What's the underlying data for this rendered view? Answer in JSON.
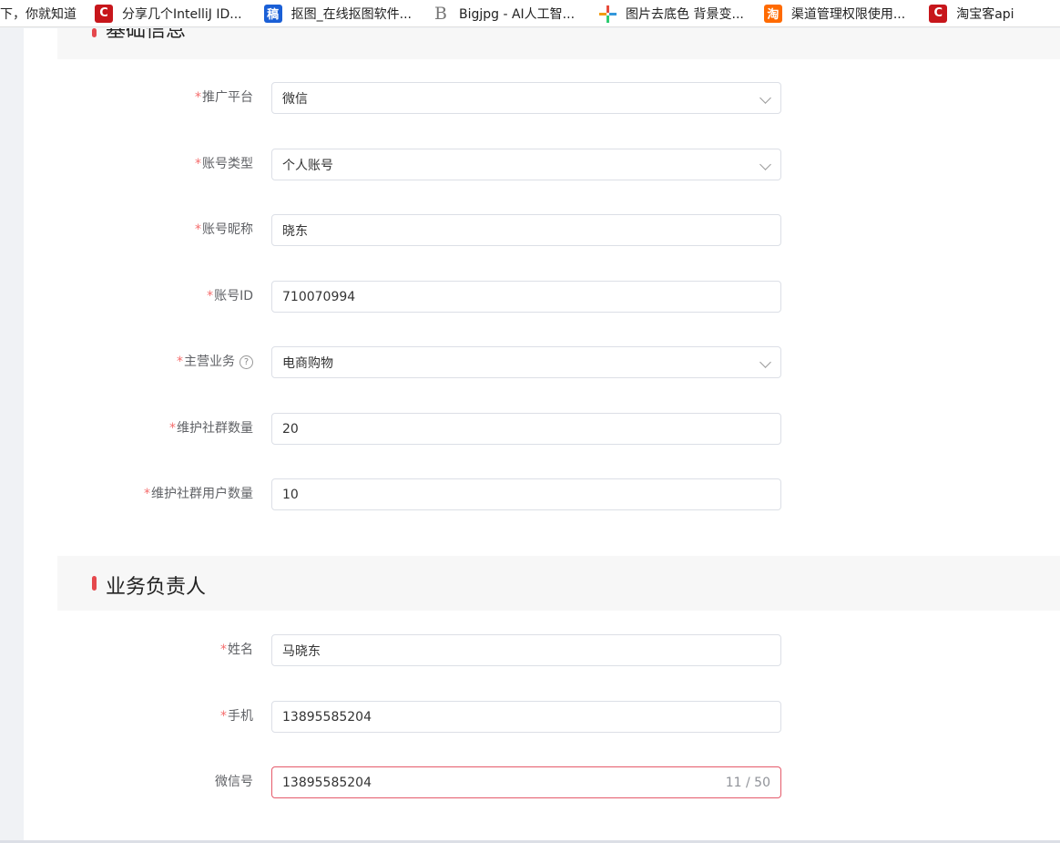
{
  "bookmarks": [
    {
      "icon": "none",
      "label": "下，你就知道"
    },
    {
      "icon": "csdn-logo-icon",
      "label": "分享几个IntelliJ ID..."
    },
    {
      "icon": "gaoding-logo-icon",
      "glyph": "稿",
      "label": "抠图_在线抠图软件..."
    },
    {
      "icon": "bigjpg-logo-icon",
      "glyph": "B",
      "label": "Bigjpg - AI人工智..."
    },
    {
      "icon": "colorful-cross-icon",
      "label": "图片去底色 背景变..."
    },
    {
      "icon": "taobao-logo-icon",
      "glyph": "淘",
      "label": "渠道管理权限使用..."
    },
    {
      "icon": "csdn-logo-icon",
      "label": "淘宝客api"
    }
  ],
  "sections": {
    "basic": {
      "title": "基础信息"
    },
    "owner": {
      "title": "业务负责人"
    }
  },
  "form": {
    "platform": {
      "label": "推广平台",
      "value": "微信"
    },
    "account_type": {
      "label": "账号类型",
      "value": "个人账号"
    },
    "nickname": {
      "label": "账号昵称",
      "value": "晓东"
    },
    "account_id": {
      "label": "账号ID",
      "value": "710070994"
    },
    "main_business": {
      "label": "主营业务",
      "value": "电商购物",
      "help": "?"
    },
    "group_count": {
      "label": "维护社群数量",
      "value": "20"
    },
    "group_user_count": {
      "label": "维护社群用户数量",
      "value": "10"
    },
    "name": {
      "label": "姓名",
      "value": "马晓东"
    },
    "phone": {
      "label": "手机",
      "value": "13895585204"
    },
    "wechat": {
      "label": "微信号",
      "value": "13895585204",
      "counter": "11 / 50"
    }
  },
  "colors": {
    "required": "#f56c6c",
    "accent_bar": "#e5484d",
    "error_border": "#e55a6a"
  }
}
